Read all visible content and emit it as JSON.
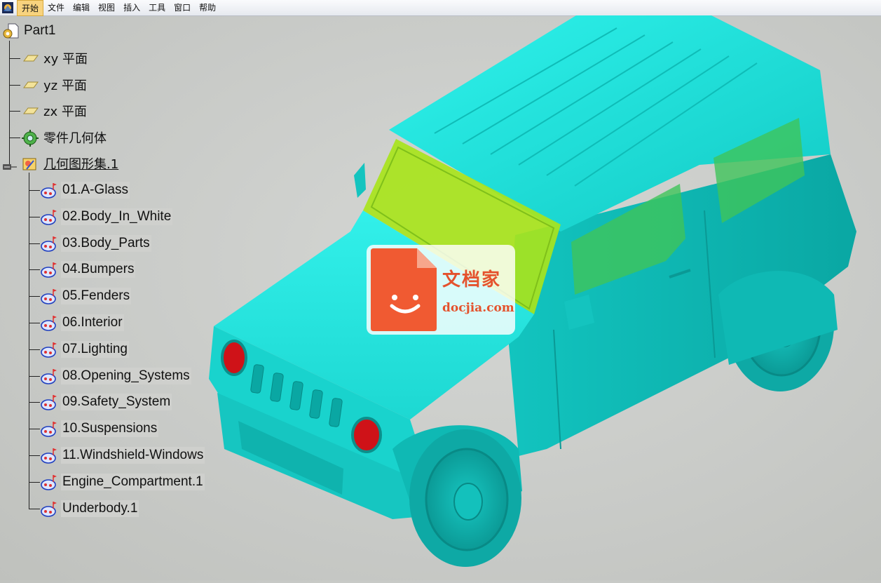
{
  "menu": {
    "items": [
      {
        "label": "开始",
        "active": true
      },
      {
        "label": "文件"
      },
      {
        "label": "编辑"
      },
      {
        "label": "视图"
      },
      {
        "label": "插入"
      },
      {
        "label": "工具"
      },
      {
        "label": "窗口"
      },
      {
        "label": "帮助"
      }
    ]
  },
  "tree": {
    "root": "Part1",
    "planes": [
      "xy 平面",
      "yz 平面",
      "zx 平面"
    ],
    "body": "零件几何体",
    "geoset": "几何图形集.1",
    "children": [
      "01.A-Glass",
      "02.Body_In_White",
      "03.Body_Parts",
      "04.Bumpers",
      "05.Fenders",
      "06.Interior",
      "07.Lighting",
      "08.Opening_Systems",
      "09.Safety_System",
      "10.Suspensions",
      "11.Windshield-Windows",
      "Engine_Compartment.1",
      "Underbody.1"
    ]
  },
  "watermark": {
    "cn": "文档家",
    "url": "docjia.com"
  },
  "colors": {
    "model": "#1fe3dc",
    "glass": "#9fe51a",
    "lamp": "#d4131a",
    "watermark": "#f05a32"
  }
}
